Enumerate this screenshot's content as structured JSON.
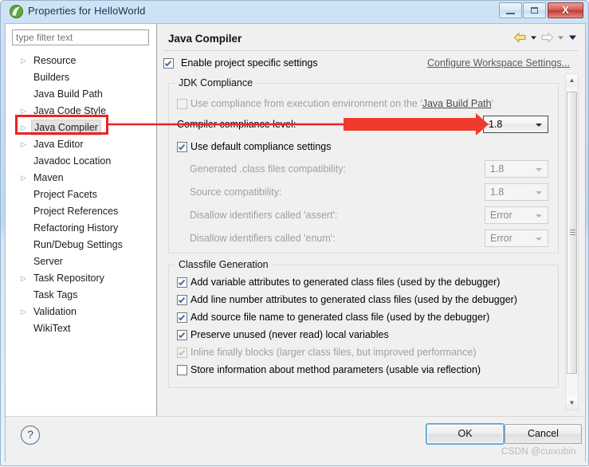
{
  "window": {
    "title": "Properties for HelloWorld",
    "icon": "eclipse-leaf-icon",
    "minimize_label": "",
    "maximize_label": "",
    "close_label": "X"
  },
  "sidebar": {
    "filter_placeholder": "type filter text",
    "filter_value": "",
    "items": [
      {
        "label": "Resource",
        "expandable": true,
        "selected": false
      },
      {
        "label": "Builders",
        "expandable": false,
        "selected": false
      },
      {
        "label": "Java Build Path",
        "expandable": false,
        "selected": false
      },
      {
        "label": "Java Code Style",
        "expandable": true,
        "selected": false
      },
      {
        "label": "Java Compiler",
        "expandable": true,
        "selected": true
      },
      {
        "label": "Java Editor",
        "expandable": true,
        "selected": false
      },
      {
        "label": "Javadoc Location",
        "expandable": false,
        "selected": false
      },
      {
        "label": "Maven",
        "expandable": true,
        "selected": false
      },
      {
        "label": "Project Facets",
        "expandable": false,
        "selected": false
      },
      {
        "label": "Project References",
        "expandable": false,
        "selected": false
      },
      {
        "label": "Refactoring History",
        "expandable": false,
        "selected": false
      },
      {
        "label": "Run/Debug Settings",
        "expandable": false,
        "selected": false
      },
      {
        "label": "Server",
        "expandable": false,
        "selected": false
      },
      {
        "label": "Task Repository",
        "expandable": true,
        "selected": false
      },
      {
        "label": "Task Tags",
        "expandable": false,
        "selected": false
      },
      {
        "label": "Validation",
        "expandable": true,
        "selected": false
      },
      {
        "label": "WikiText",
        "expandable": false,
        "selected": false
      }
    ],
    "expand_arrow_glyph": "▷"
  },
  "content": {
    "page_title": "Java Compiler",
    "nav": {
      "back_icon": "back-arrow-icon",
      "back_menu_icon": "chevron-down-icon",
      "forward_icon": "forward-arrow-icon",
      "forward_menu_icon": "chevron-down-icon",
      "view_menu_icon": "chevron-down-icon"
    },
    "enable_project_specific": {
      "label": "Enable project specific settings",
      "checked": true
    },
    "workspace_link": "Configure Workspace Settings...",
    "jdk_group": {
      "title": "JDK Compliance",
      "use_execution_env": {
        "label_prefix": "Use compliance from execution environment on the '",
        "label_link": "Java Build Path",
        "label_suffix": "'",
        "checked": false,
        "enabled": false
      },
      "compliance_level": {
        "label": "Compiler compliance level:",
        "value": "1.8",
        "enabled": true,
        "focused": true
      },
      "use_default_compliance": {
        "label": "Use default compliance settings",
        "checked": true,
        "enabled": true
      },
      "rows": [
        {
          "label": "Generated .class files compatibility:",
          "value": "1.8",
          "enabled": false
        },
        {
          "label": "Source compatibility:",
          "value": "1.8",
          "enabled": false
        },
        {
          "label": "Disallow identifiers called 'assert':",
          "value": "Error",
          "enabled": false
        },
        {
          "label": "Disallow identifiers called 'enum':",
          "value": "Error",
          "enabled": false
        }
      ]
    },
    "classfile_group": {
      "title": "Classfile Generation",
      "options": [
        {
          "label": "Add variable attributes to generated class files (used by the debugger)",
          "checked": true,
          "enabled": true
        },
        {
          "label": "Add line number attributes to generated class files (used by the debugger)",
          "checked": true,
          "enabled": true
        },
        {
          "label": "Add source file name to generated class file (used by the debugger)",
          "checked": true,
          "enabled": true
        },
        {
          "label": "Preserve unused (never read) local variables",
          "checked": true,
          "enabled": true
        },
        {
          "label": "Inline finally blocks (larger class files, but improved performance)",
          "checked": true,
          "enabled": false
        },
        {
          "label": "Store information about method parameters (usable via reflection)",
          "checked": false,
          "enabled": true
        }
      ]
    },
    "scrollbar": {
      "up_glyph": "▲",
      "down_glyph": "▼"
    }
  },
  "footer": {
    "help_glyph": "?",
    "ok_label": "OK",
    "cancel_label": "Cancel",
    "watermark": "CSDN @cuixubin"
  },
  "colors": {
    "annotation_red": "#ee2222",
    "title_bar_blue": "#bfd9f2",
    "focus_blue": "#4aa3d8"
  }
}
